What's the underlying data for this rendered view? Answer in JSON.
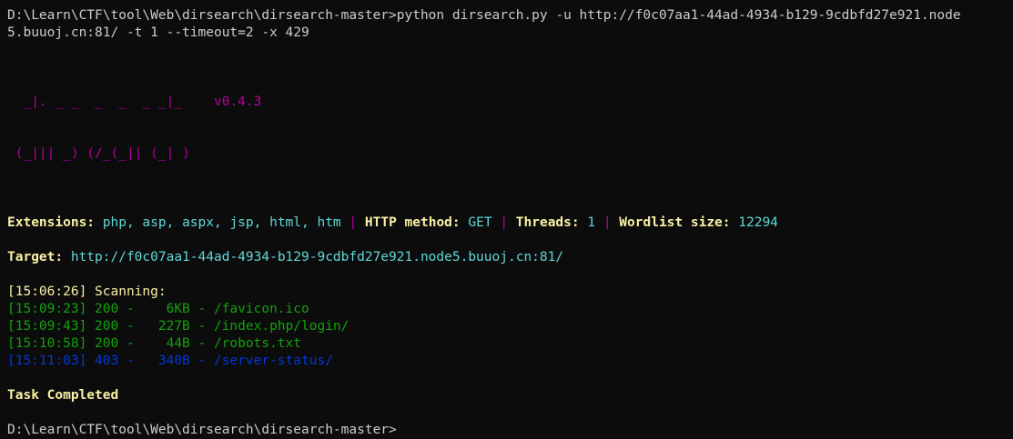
{
  "command": {
    "line1": "D:\\Learn\\CTF\\tool\\Web\\dirsearch\\dirsearch-master>python dirsearch.py -u http://f0c07aa1-44ad-4934-b129-9cdbfd27e921.node",
    "line2": "5.buuoj.cn:81/ -t 1 --timeout=2 -x 429"
  },
  "logo": {
    "row1": "  _|. _ _  _  _  _ _|_    ",
    "row2": " (_||| _) (/_(_|| (_| )   ",
    "version": "v0.4.3"
  },
  "config": {
    "extensions_label": "Extensions:",
    "extensions_value": "php, asp, aspx, jsp, html, htm",
    "sep1": "|",
    "http_method_label": "HTTP method:",
    "http_method_value": "GET",
    "sep2": "|",
    "threads_label": "Threads:",
    "threads_value": "1",
    "sep3": "|",
    "wordlist_label": "Wordlist size:",
    "wordlist_value": "12294"
  },
  "target": {
    "label": "Target:",
    "url": "http://f0c07aa1-44ad-4934-b129-9cdbfd27e921.node5.buuoj.cn:81/"
  },
  "scan": {
    "header": "[15:06:26] Scanning:",
    "results": [
      {
        "text": "[15:09:23] 200 -    6KB - /favicon.ico",
        "color": "#13a10e"
      },
      {
        "text": "[15:09:43] 200 -   227B - /index.php/login/",
        "color": "#13a10e"
      },
      {
        "text": "[15:10:58] 200 -    44B - /robots.txt",
        "color": "#13a10e"
      },
      {
        "text": "[15:11:03] 403 -   340B - /server-status/",
        "color": "#0037da"
      }
    ]
  },
  "status": {
    "completed": "Task Completed"
  },
  "prompt": {
    "text": "D:\\Learn\\CTF\\tool\\Web\\dirsearch\\dirsearch-master>"
  },
  "colors": {
    "background": "#0c0c0c",
    "foreground": "#cccccc",
    "label_yellow": "#f9f1a5",
    "value_cyan": "#61d6d6",
    "logo_magenta": "#b4009e",
    "ok_green": "#13a10e",
    "forbidden_blue": "#0037da"
  }
}
